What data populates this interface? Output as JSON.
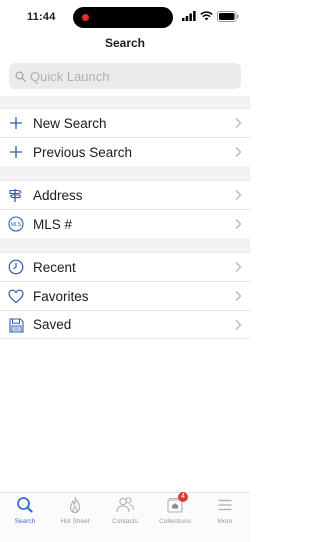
{
  "status_bar": {
    "time": "11:44"
  },
  "nav": {
    "title": "Search"
  },
  "search": {
    "placeholder": "Quick Launch"
  },
  "groups": [
    [
      {
        "label": "New Search",
        "icon": "plus-icon"
      },
      {
        "label": "Previous Search",
        "icon": "plus-icon"
      }
    ],
    [
      {
        "label": "Address",
        "icon": "signpost-icon"
      },
      {
        "label": "MLS #",
        "icon": "mls-icon",
        "icon_text": "MLS"
      }
    ],
    [
      {
        "label": "Recent",
        "icon": "clock-icon"
      },
      {
        "label": "Favorites",
        "icon": "heart-icon"
      },
      {
        "label": "Saved",
        "icon": "floppy-disk-icon"
      }
    ]
  ],
  "tabs": [
    {
      "label": "Search",
      "icon": "search-icon",
      "active": true
    },
    {
      "label": "Hot Sheet",
      "icon": "flame-icon"
    },
    {
      "label": "Contacts",
      "icon": "contacts-icon"
    },
    {
      "label": "Collections",
      "icon": "collections-icon",
      "badge": "4"
    },
    {
      "label": "More",
      "icon": "menu-icon"
    }
  ],
  "colors": {
    "accent": "#3a6fd0",
    "icon": "#2f5fae",
    "badge": "#e03b30",
    "separator": "#f2f2f4"
  }
}
